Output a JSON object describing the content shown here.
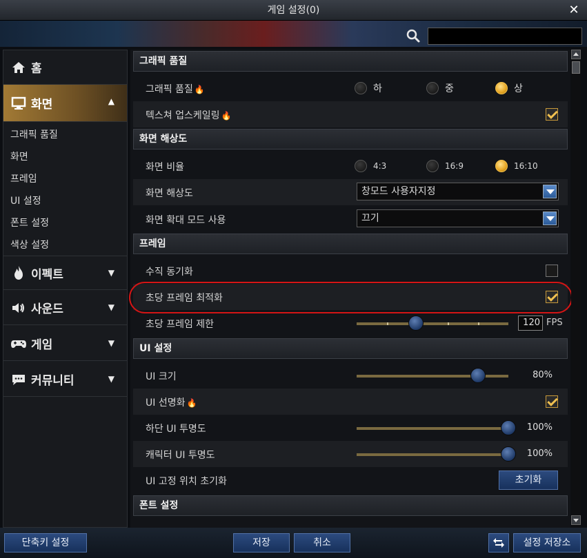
{
  "window": {
    "title": "게임 설정(0)",
    "close_glyph": "✕"
  },
  "search": {
    "value": "",
    "placeholder": ""
  },
  "sidebar": {
    "categories": [
      {
        "label": "홈",
        "icon": "home-icon"
      },
      {
        "label": "화면",
        "icon": "monitor-icon",
        "arrow": "▲"
      },
      {
        "label": "이펙트",
        "icon": "flame-icon",
        "arrow": "▼"
      },
      {
        "label": "사운드",
        "icon": "speaker-icon",
        "arrow": "▼"
      },
      {
        "label": "게임",
        "icon": "gamepad-icon",
        "arrow": "▼"
      },
      {
        "label": "커뮤니티",
        "icon": "chat-icon",
        "arrow": "▼"
      }
    ],
    "sub_items": [
      "그래픽 품질",
      "화면",
      "프레임",
      "UI 설정",
      "폰트 설정",
      "색상 설정"
    ]
  },
  "sections": {
    "graphics": "그래픽 품질",
    "resolution": "화면 해상도",
    "frame": "프레임",
    "ui": "UI 설정",
    "font": "폰트 설정"
  },
  "rows": {
    "graphics_quality": {
      "label": "그래픽 품질",
      "options": [
        "하",
        "중",
        "상"
      ],
      "selected": "상"
    },
    "texture_upscale": {
      "label": "텍스쳐 업스케일링",
      "checked": true
    },
    "aspect_ratio": {
      "label": "화면 비율",
      "options": [
        "4:3",
        "16:9",
        "16:10"
      ],
      "selected": "16:10"
    },
    "resolution": {
      "label": "화면 해상도",
      "value": "창모드 사용자지정"
    },
    "zoom_mode": {
      "label": "화면 확대 모드 사용",
      "value": "끄기"
    },
    "vsync": {
      "label": "수직 동기화",
      "checked": false
    },
    "frame_opt": {
      "label": "초당 프레임 최적화",
      "checked": true
    },
    "frame_limit": {
      "label": "초당 프레임 제한",
      "value": "120",
      "unit": "FPS",
      "level": 0.39
    },
    "ui_size": {
      "label": "UI 크기",
      "value": "80%",
      "level": 0.8
    },
    "ui_sharpen": {
      "label": "UI 선명화",
      "checked": true
    },
    "bottom_ui_opacity": {
      "label": "하단 UI 투명도",
      "value": "100%",
      "level": 1.0
    },
    "char_ui_opacity": {
      "label": "캐릭터 UI 투명도",
      "value": "100%",
      "level": 1.0
    },
    "ui_reset": {
      "label": "UI 고정 위치 초기화",
      "button": "초기화"
    }
  },
  "footer": {
    "shortcut": "단축키 설정",
    "save": "저장",
    "cancel": "취소",
    "storage": "설정 저장소",
    "storage_icon": "refresh-icon"
  },
  "colors": {
    "accent_gold": "#e5a523",
    "highlight_red": "#d41515",
    "button_blue": "#2c4a7e"
  }
}
